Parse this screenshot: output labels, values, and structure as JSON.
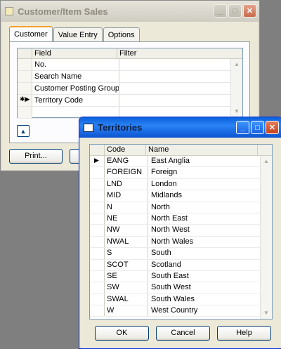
{
  "back_window": {
    "title": "Customer/Item Sales",
    "tabs": [
      "Customer",
      "Value Entry",
      "Options"
    ],
    "columns": [
      "Field",
      "Filter"
    ],
    "rows": [
      {
        "field": "No.",
        "filter": ""
      },
      {
        "field": "Search Name",
        "filter": ""
      },
      {
        "field": "Customer Posting Group",
        "filter": ""
      },
      {
        "field": "Territory Code",
        "filter": ""
      },
      {
        "field": "",
        "filter": ""
      }
    ],
    "print_label": "Print..."
  },
  "front_window": {
    "title": "Territories",
    "columns": [
      "Code",
      "Name"
    ],
    "rows": [
      {
        "code": "EANG",
        "name": "East Anglia"
      },
      {
        "code": "FOREIGN",
        "name": "Foreign"
      },
      {
        "code": "LND",
        "name": "London"
      },
      {
        "code": "MID",
        "name": "Midlands"
      },
      {
        "code": "N",
        "name": "North"
      },
      {
        "code": "NE",
        "name": "North East"
      },
      {
        "code": "NW",
        "name": "North West"
      },
      {
        "code": "NWAL",
        "name": "North Wales"
      },
      {
        "code": "S",
        "name": "South"
      },
      {
        "code": "SCOT",
        "name": "Scotland"
      },
      {
        "code": "SE",
        "name": "South East"
      },
      {
        "code": "SW",
        "name": "South West"
      },
      {
        "code": "SWAL",
        "name": "South Wales"
      },
      {
        "code": "W",
        "name": "West Country"
      }
    ],
    "ok_label": "OK",
    "cancel_label": "Cancel",
    "help_label": "Help"
  },
  "colors": {
    "accent": "#0a5fd8",
    "tab_highlight": "#f3a130"
  },
  "icons": [
    "window-icon",
    "minimize-icon",
    "maximize-icon",
    "close-icon",
    "up-arrow-icon",
    "row-pointer-icon"
  ]
}
